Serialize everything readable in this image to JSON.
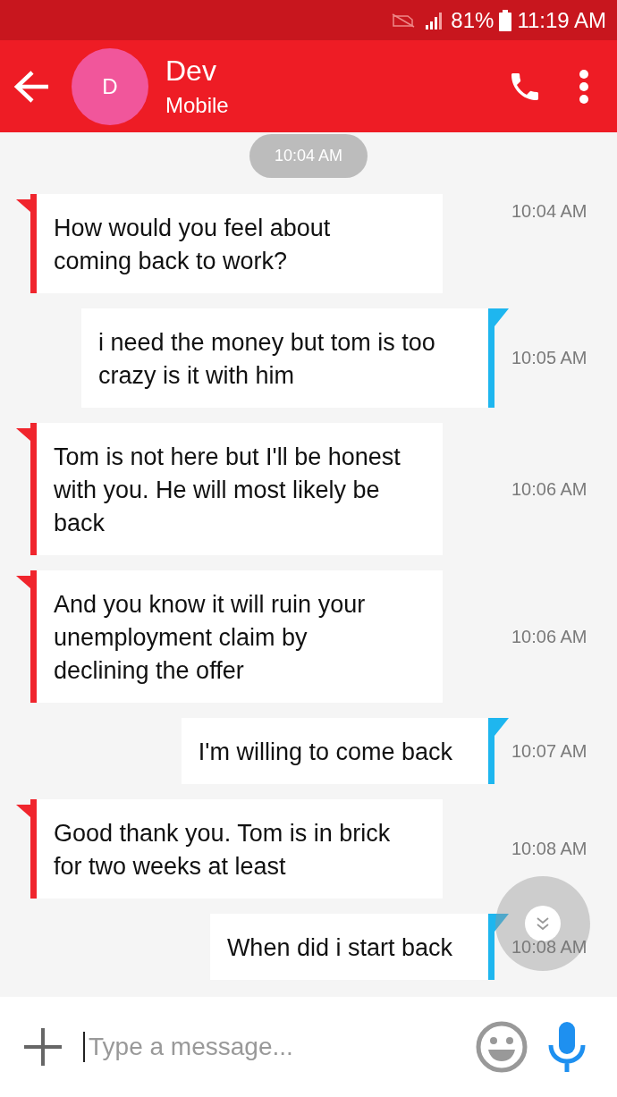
{
  "status_bar": {
    "battery": "81%",
    "time": "11:19 AM"
  },
  "header": {
    "avatar": "D",
    "name": "Dev",
    "subtitle": "Mobile"
  },
  "date_chip": "10:04 AM",
  "messages": [
    {
      "kind": "received",
      "text": "How would you feel about coming back to work?",
      "time": "10:04 AM"
    },
    {
      "kind": "sent",
      "text": "i need the money but tom is too crazy is it with him",
      "time": "10:05 AM"
    },
    {
      "kind": "received",
      "text": "Tom is not here but I'll be honest with you. He will most likely be back",
      "time": "10:06 AM"
    },
    {
      "kind": "received",
      "text": "And you know it will ruin your unemployment claim by declining the offer",
      "time": "10:06 AM"
    },
    {
      "kind": "sent",
      "text": "I'm willing to come back",
      "time": "10:07 AM"
    },
    {
      "kind": "received",
      "text": "Good thank you. Tom is in brick for two weeks at least",
      "time": "10:08 AM"
    },
    {
      "kind": "sent",
      "text": "When did i start back",
      "time": "10:08 AM"
    }
  ],
  "composer": {
    "placeholder": "Type a message..."
  }
}
